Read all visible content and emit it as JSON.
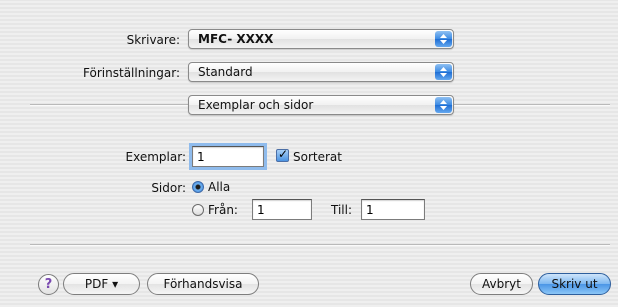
{
  "printer": {
    "label": "Skrivare:",
    "value": "MFC- XXXX"
  },
  "presets": {
    "label": "Förinställningar:",
    "value": "Standard"
  },
  "panel": {
    "value": "Exemplar och sidor"
  },
  "copies": {
    "label": "Exemplar:",
    "value": "1",
    "collate_label": "Sorterat",
    "collate_checked": true
  },
  "pages": {
    "label": "Sidor:",
    "all_label": "Alla",
    "all_selected": true,
    "from_label": "Från:",
    "from_value": "1",
    "to_label": "Till:",
    "to_value": "1"
  },
  "footer": {
    "help_label": "?",
    "pdf_label": "PDF ▾",
    "preview_label": "Förhandsvisa",
    "cancel_label": "Avbryt",
    "print_label": "Skriv ut"
  },
  "colors": {
    "accent": "#3b8ae3",
    "help_purple": "#7a4ab0"
  },
  "icons": [
    "stepper-arrows-icon",
    "checkmark-icon",
    "radio-dot-icon"
  ]
}
